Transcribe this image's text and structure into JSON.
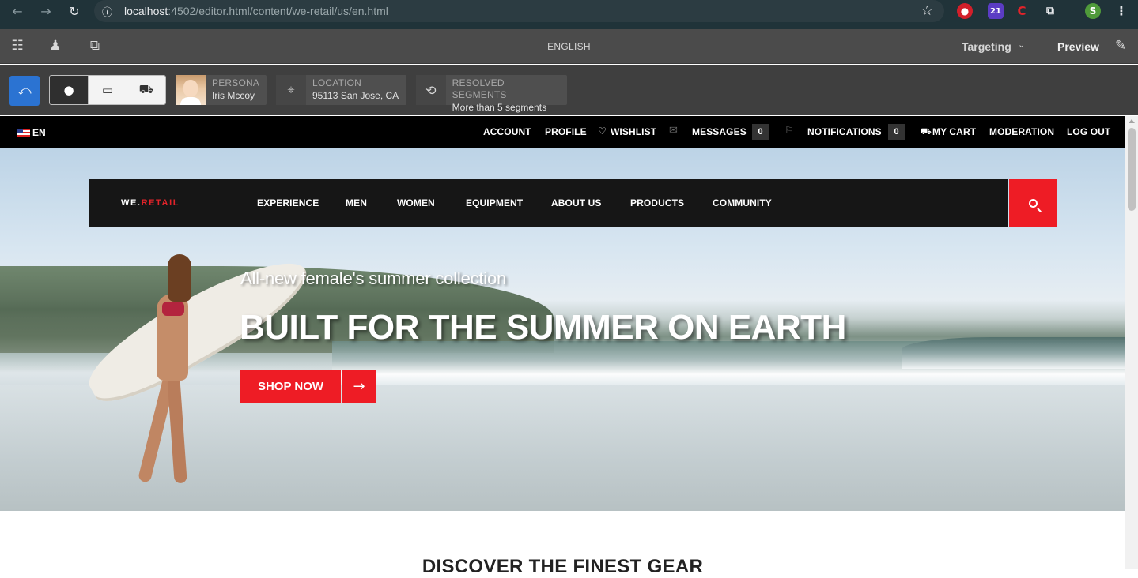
{
  "browser": {
    "url_host": "localhost",
    "url_rest": ":4502/editor.html/content/we-retail/us/en.html",
    "icons": [
      "back-icon",
      "forward-icon",
      "reload-icon",
      "site-info-icon",
      "bookmark-star-icon",
      "extensions-icon",
      "menu-icon"
    ],
    "extension_badge": "21",
    "profile_initial": "S"
  },
  "editor": {
    "language": "ENGLISH",
    "targeting_label": "Targeting",
    "preview_label": "Preview"
  },
  "context_hub": {
    "persona_label": "PERSONA",
    "persona_value": "Iris Mccoy",
    "location_label": "LOCATION",
    "location_value": "95113 San Jose, CA",
    "segments_label": "RESOLVED SEGMENTS",
    "segments_value": "More than 5 segments"
  },
  "site_top": {
    "language": "EN",
    "links": {
      "account": "ACCOUNT",
      "profile": "PROFILE",
      "wishlist": "WISHLIST",
      "messages": "MESSAGES",
      "messages_count": "0",
      "notifications": "NOTIFICATIONS",
      "notifications_count": "0",
      "cart": "MY CART",
      "moderation": "MODERATION",
      "logout": "LOG OUT"
    }
  },
  "main_nav": {
    "logo_prefix": "WE.",
    "logo_suffix": "RETAIL",
    "items": [
      "EXPERIENCE",
      "MEN",
      "WOMEN",
      "EQUIPMENT",
      "ABOUT US",
      "PRODUCTS",
      "COMMUNITY"
    ]
  },
  "hero": {
    "subtitle": "All-new female's summer collection",
    "title": "BUILT FOR THE SUMMER ON EARTH",
    "cta": "SHOP NOW"
  },
  "section": {
    "heading": "DISCOVER THE FINEST GEAR"
  },
  "colors": {
    "brand_red": "#ee1c25",
    "editor_blue": "#2b73d2"
  }
}
